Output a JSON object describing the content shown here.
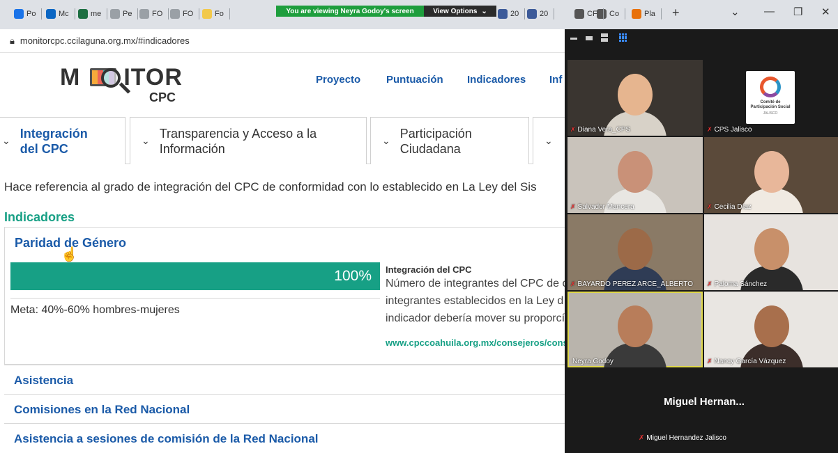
{
  "browser": {
    "tabs": [
      {
        "label": "Po",
        "color": "#1a73e8"
      },
      {
        "label": "Mc",
        "color": "#0b66c3"
      },
      {
        "label": "me",
        "color": "#1d6f42"
      },
      {
        "label": "Pe",
        "color": "#9aa0a6"
      },
      {
        "label": "FO",
        "color": "#9aa0a6"
      },
      {
        "label": "FO",
        "color": "#9aa0a6"
      },
      {
        "label": "Fo",
        "color": "#f2c94c"
      },
      {
        "label": "20",
        "color": "#3c5a99"
      },
      {
        "label": "20",
        "color": "#3c5a99"
      },
      {
        "label": "CF",
        "color": "#555"
      },
      {
        "label": "Co",
        "color": "#555"
      },
      {
        "label": "Pla",
        "color": "#e8710a"
      }
    ],
    "url": "monitorcpc.ccilaguna.org.mx/#indicadores",
    "plus": "+",
    "win_chevron": "⌄",
    "win_min": "—",
    "win_max": "❐",
    "win_close": "✕"
  },
  "share": {
    "banner": "You are viewing Neyra Godoy's screen",
    "view_options": "View Options",
    "view_chevron": "⌄"
  },
  "site": {
    "logo_word": "MONITOR",
    "logo_sub": "CPC",
    "nav": [
      "Proyecto",
      "Puntuación",
      "Indicadores",
      "Inf"
    ],
    "tabs": [
      {
        "line1": "Integración",
        "line2": "del CPC"
      },
      {
        "line1": "Transparencia y Acceso a la",
        "line2": "Información"
      },
      {
        "line1": "Participación",
        "line2": "Ciudadana"
      },
      {
        "line1": "",
        "line2": ""
      }
    ],
    "description": "Hace referencia al grado de integración del CPC de conformidad con lo establecido en La Ley del Sis",
    "indicators_title": "Indicadores",
    "panel": {
      "title": "Paridad de Género",
      "progress": 1.0,
      "progress_label": "100%",
      "meta": "Meta: 40%-60% hombres-mujeres",
      "info_heading": "Integración del CPC",
      "info_lines": [
        "Número de integrantes del CPC de c",
        "integrantes establecidos en la Ley d",
        "indicador debería mover su proporcí"
      ],
      "info_link": "www.cpccoahuila.org.mx/consejeros/cons"
    },
    "accordion": [
      "Asistencia",
      "Comisiones en la Red Nacional",
      "Asistencia a sesiones de comisión de la Red Nacional"
    ]
  },
  "meeting": {
    "participants": [
      {
        "name": "Diana Vera_CPS",
        "bg": "#3a3530",
        "skin": "#e6b58f",
        "shirt": "#d8d2c8"
      },
      {
        "name": "CPS Jalisco",
        "bg": "#1a1a1a",
        "skin": "",
        "shirt": ""
      },
      {
        "name": "Salvador Mancera",
        "bg": "#c9c3bb",
        "skin": "#c99178",
        "shirt": "#e8e6e2"
      },
      {
        "name": "Cecilia Díaz",
        "bg": "#5b4a3a",
        "skin": "#e8b79a",
        "shirt": "#f0eae2"
      },
      {
        "name": "BAYARDO PEREZ ARCE_ALBERTO",
        "bg": "#8a7a66",
        "skin": "#9c6a48",
        "shirt": "#2f3c55"
      },
      {
        "name": "Paloma Sánchez",
        "bg": "#e7e3df",
        "skin": "#c8906a",
        "shirt": "#2a2a2a"
      },
      {
        "name": "Neyra Godoy",
        "bg": "#b9b4ac",
        "skin": "#b87d5a",
        "shirt": "#3a3a3a"
      },
      {
        "name": "Nancy García Vázquez",
        "bg": "#e9e6e2",
        "skin": "#a86f4c",
        "shirt": "#3c2e2a"
      }
    ],
    "logo_text": "Comité de Participación Social",
    "logo_sub": "JALISCO",
    "active_speaker": "Miguel Hernan...",
    "active_speaker_full": "Miguel Hernandez Jalisco"
  }
}
